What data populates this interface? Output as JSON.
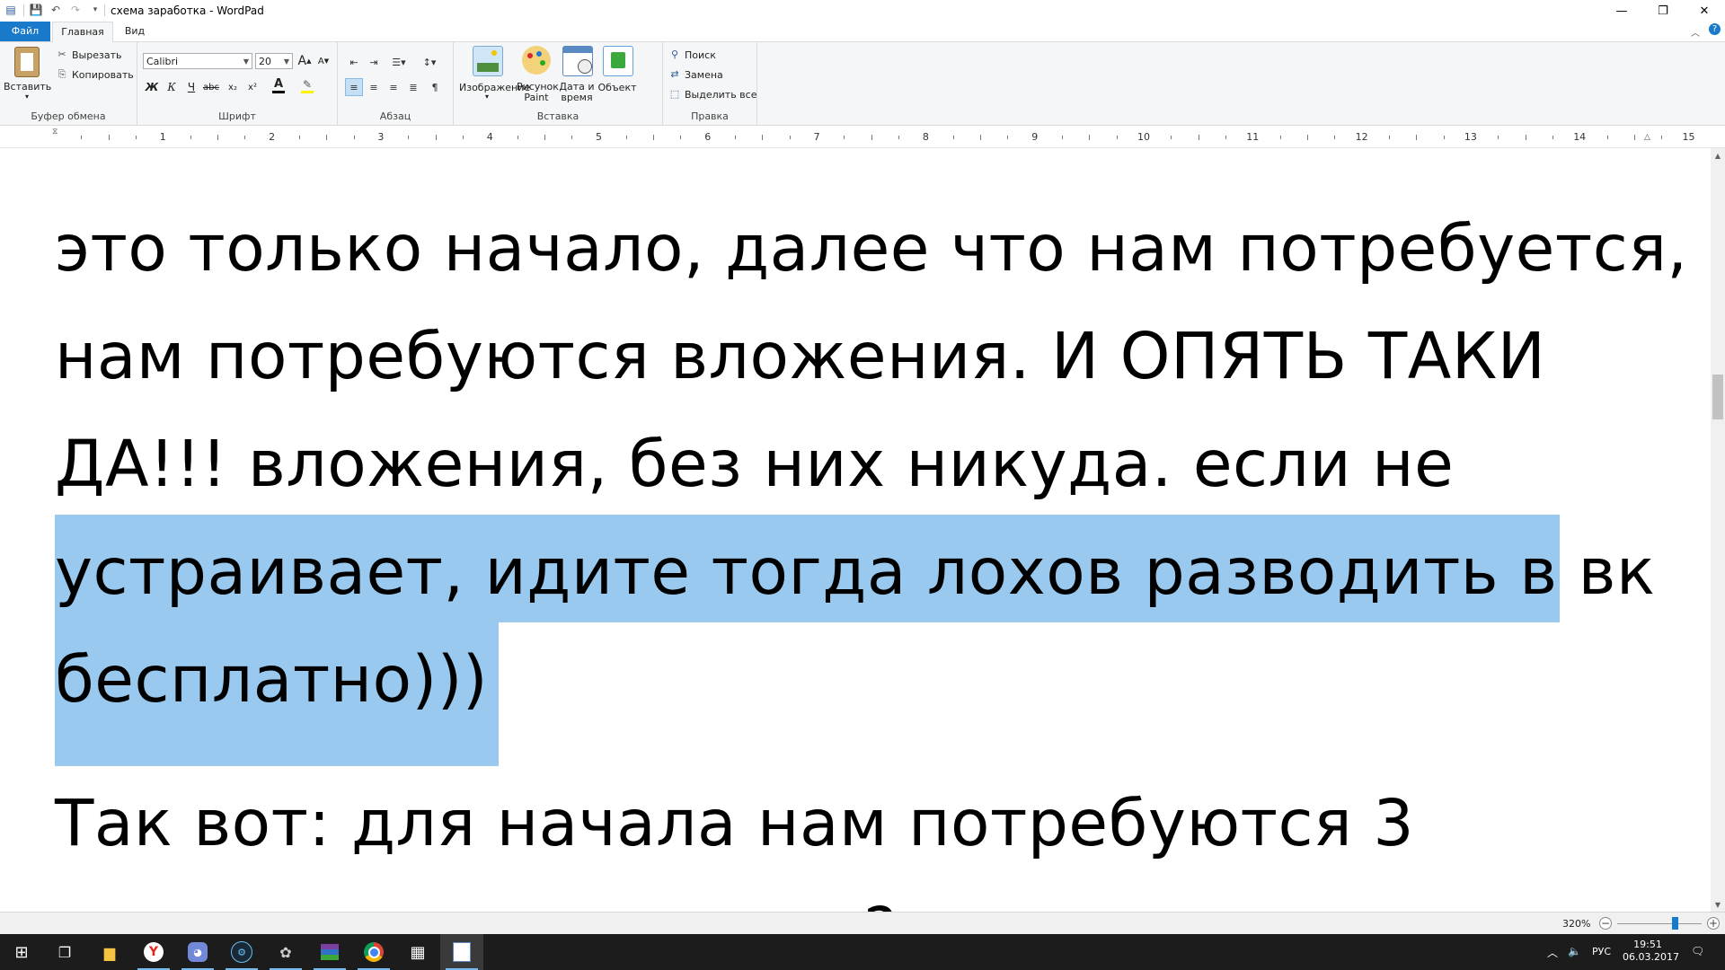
{
  "window": {
    "title": "схема заработка - WordPad"
  },
  "tabs": {
    "file": "Файл",
    "home": "Главная",
    "view": "Вид"
  },
  "ribbon": {
    "clipboard": {
      "label": "Буфер обмена",
      "paste": "Вставить",
      "cut": "Вырезать",
      "copy": "Копировать"
    },
    "font": {
      "label": "Шрифт",
      "family": "Calibri",
      "size": "20",
      "bold": "Ж",
      "italic": "К",
      "underline": "Ч",
      "strike": "abc",
      "subscript": "x₂",
      "superscript": "x²",
      "grow": "A",
      "shrink": "A"
    },
    "paragraph": {
      "label": "Абзац"
    },
    "insert": {
      "label": "Вставка",
      "picture": "Изображение",
      "paint_line1": "Рисунок",
      "paint_line2": "Paint",
      "datetime_line1": "Дата и",
      "datetime_line2": "время",
      "object": "Объект"
    },
    "editing": {
      "label": "Правка",
      "find": "Поиск",
      "replace": "Замена",
      "select_all": "Выделить все"
    }
  },
  "ruler": {
    "numbers": [
      "1",
      "2",
      "3",
      "4",
      "5",
      "6",
      "7",
      "8",
      "9",
      "10",
      "11",
      "12",
      "13",
      "14",
      "15"
    ]
  },
  "document": {
    "lines": [
      "это только начало, далее что нам потребуется,",
      "нам потребуются вложения. И ОПЯТЬ ТАКИ",
      "ДА!!! вложения, без них никуда.  если не",
      "устраивает, идите тогда лохов разводить в вк",
      "бесплатно)))",
      "Так вот: для начала нам потребуются 3",
      "?"
    ],
    "selection_color": "#99c9ef"
  },
  "statusbar": {
    "zoom": "320%",
    "zoom_level": 0.68
  },
  "taskbar": {
    "lang": "РУС",
    "time": "19:51",
    "date": "06.03.2017"
  },
  "colors": {
    "accent": "#1979ca",
    "ribbon_bg": "#f5f6f7",
    "taskbar_bg": "#1c1c1c"
  }
}
